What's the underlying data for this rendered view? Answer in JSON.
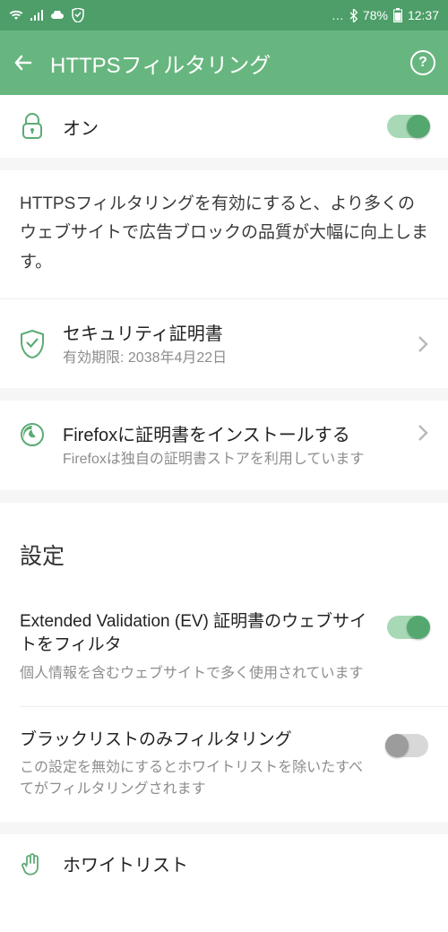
{
  "status": {
    "battery": "78%",
    "time": "12:37",
    "dots": "…"
  },
  "appbar": {
    "title": "HTTPSフィルタリング"
  },
  "main_toggle": {
    "label": "オン",
    "on": true
  },
  "description": "HTTPSフィルタリングを有効にすると、より多くのウェブサイトで広告ブロックの品質が大幅に向上します。",
  "rows": {
    "cert": {
      "title": "セキュリティ証明書",
      "subtitle": "有効期限: 2038年4月22日"
    },
    "firefox": {
      "title": "Firefoxに証明書をインストールする",
      "subtitle": "Firefoxは独自の証明書ストアを利用しています"
    }
  },
  "settings_header": "設定",
  "settings": {
    "ev": {
      "title": "Extended Validation (EV) 証明書のウェブサイトをフィルタ",
      "subtitle": "個人情報を含むウェブサイトで多く使用されています",
      "on": true
    },
    "blacklist": {
      "title": "ブラックリストのみフィルタリング",
      "subtitle": "この設定を無効にするとホワイトリストを除いたすべてがフィルタリングされます",
      "on": false
    },
    "whitelist": {
      "title": "ホワイトリスト"
    }
  }
}
